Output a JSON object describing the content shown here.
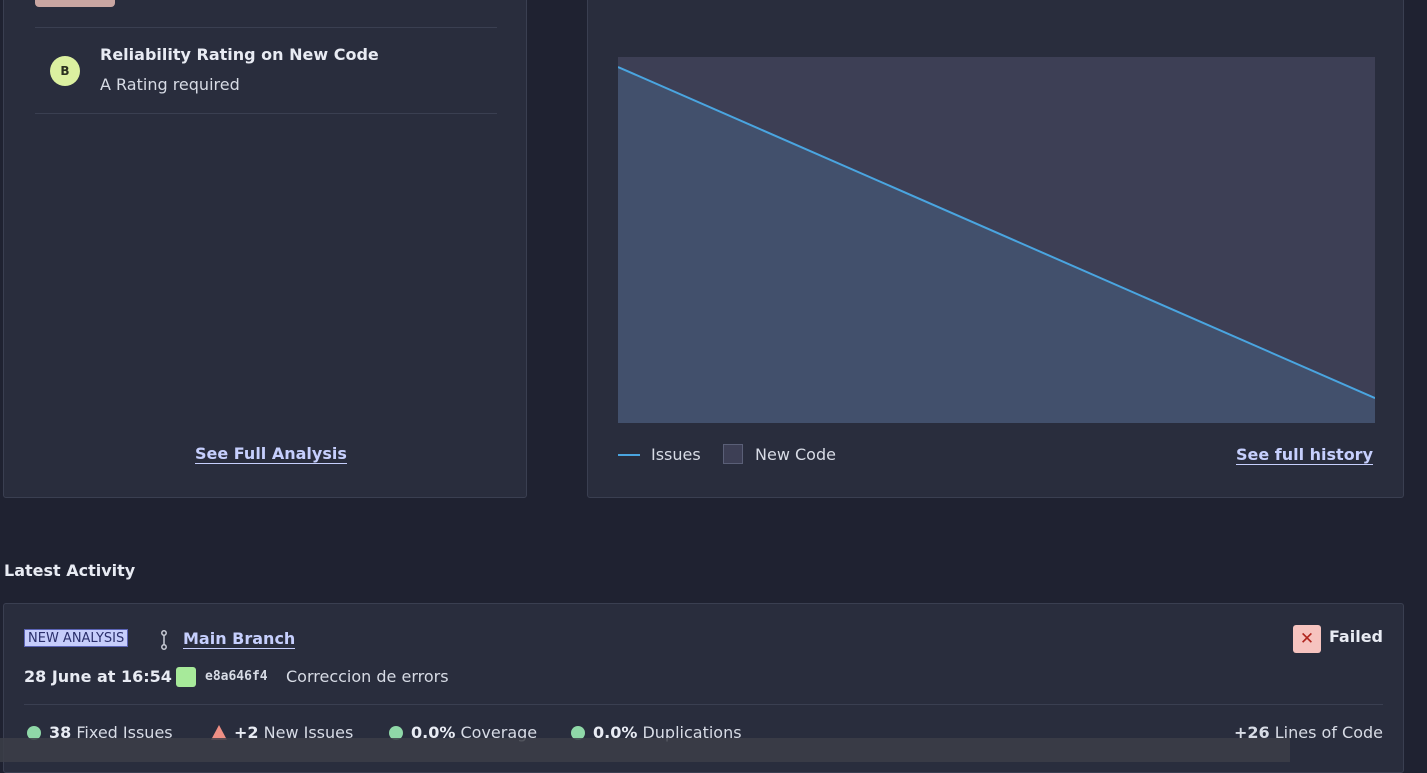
{
  "quality_gate": {
    "condition_title": "Reliability Rating on New Code",
    "condition_rating": "B",
    "condition_subtitle": "A Rating required",
    "see_full_analysis": "See Full Analysis"
  },
  "history_chart": {
    "legend_issues": "Issues",
    "legend_new_code": "New Code",
    "see_full_history": "See full history",
    "colors": {
      "line": "#4aa5e0",
      "new_code_area": "#3d3f55",
      "area_fill": "#42506c"
    }
  },
  "chart_data": {
    "type": "area",
    "series": [
      {
        "name": "Issues",
        "values": [
          1.0,
          0.07
        ]
      }
    ],
    "new_code_period": "full"
  },
  "latest_activity": {
    "title": "Latest Activity",
    "tag": "NEW ANALYSIS",
    "branch": "Main Branch",
    "date": "28 June at 16:54",
    "commit_hash": "e8a646f4",
    "commit_message": "Correccion de errors",
    "status": "Failed",
    "metrics": {
      "fixed_value": "38",
      "fixed_label": "Fixed Issues",
      "new_value": "+2",
      "new_label": "New Issues",
      "coverage_value": "0.0%",
      "coverage_label": "Coverage",
      "dup_value": "0.0%",
      "dup_label": "Duplications",
      "loc_value": "+26",
      "loc_label": "Lines of Code"
    }
  }
}
